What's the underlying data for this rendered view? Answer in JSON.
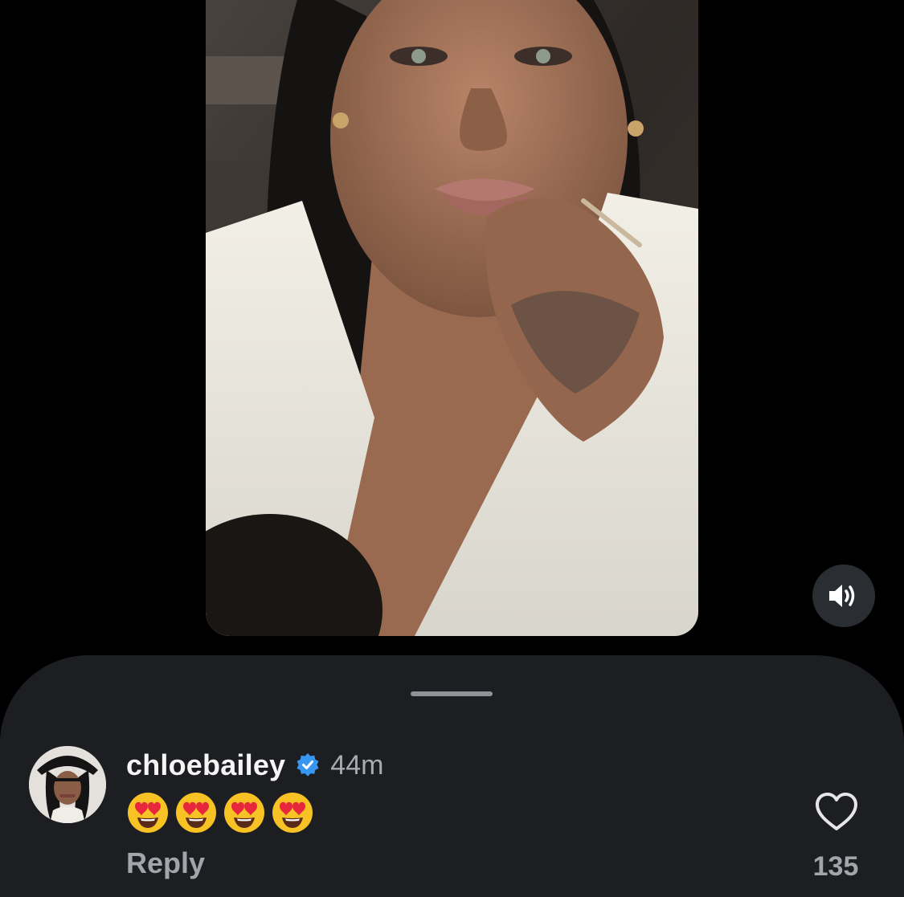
{
  "video": {
    "media_icon": "video-still-portrait",
    "mute_icon": "speaker-icon"
  },
  "comment": {
    "username": "chloebailey",
    "verified_icon": "verified-badge-icon",
    "verified_color": "#3797f0",
    "timestamp": "44m",
    "emojis": [
      "😍",
      "😍",
      "😍",
      "😍"
    ],
    "reply_label": "Reply",
    "like_icon": "heart-outline-icon",
    "like_count": "135"
  },
  "colors": {
    "background": "#000000",
    "sheet": "#1c1e21",
    "muted_text": "#a2a6ab",
    "primary_text": "#f5f5f5"
  }
}
